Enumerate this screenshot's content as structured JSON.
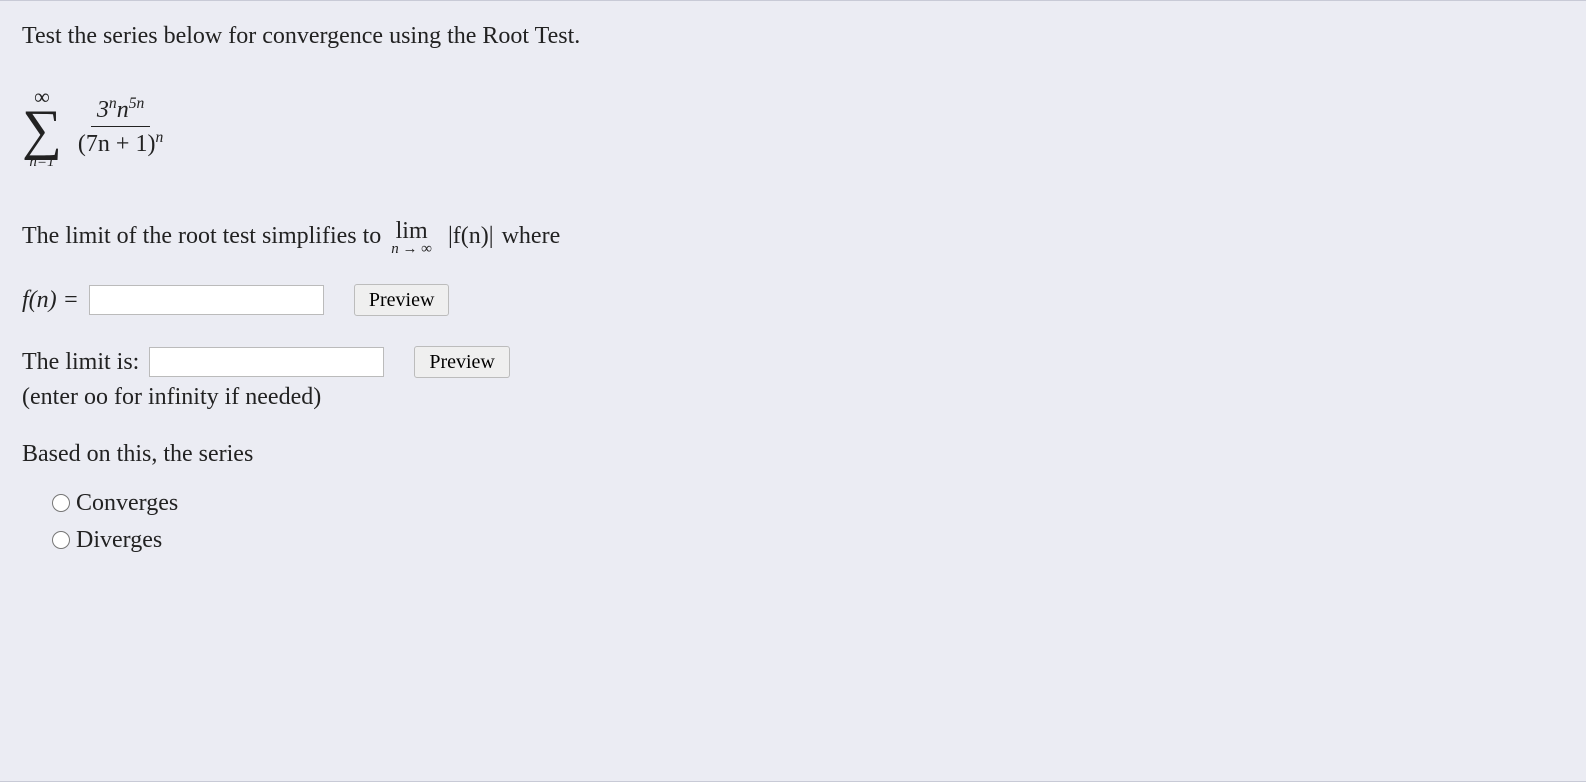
{
  "question": {
    "prompt": "Test the series below for convergence using the Root Test.",
    "sum_upper": "∞",
    "sum_lower_html": "n=1",
    "numerator_html": "3<sup>n</sup>n<sup>5n</sup>",
    "denominator_html": "(7n + 1)<sup>n</sup>",
    "limit_sentence_pre": "The limit of the root test simplifies to",
    "limit_sentence_post": "where",
    "lim_label": "lim",
    "lim_sub_html": "n → ∞",
    "fn_abs_html": "|f(n)|",
    "fn_label_html": "f(n) =",
    "fn_value": "",
    "preview_label": "Preview",
    "limit_label": "The limit is:",
    "limit_value": "",
    "limit_hint": "(enter oo for infinity if needed)",
    "based_on": "Based on this, the series",
    "options": {
      "converges": "Converges",
      "diverges": "Diverges"
    }
  }
}
